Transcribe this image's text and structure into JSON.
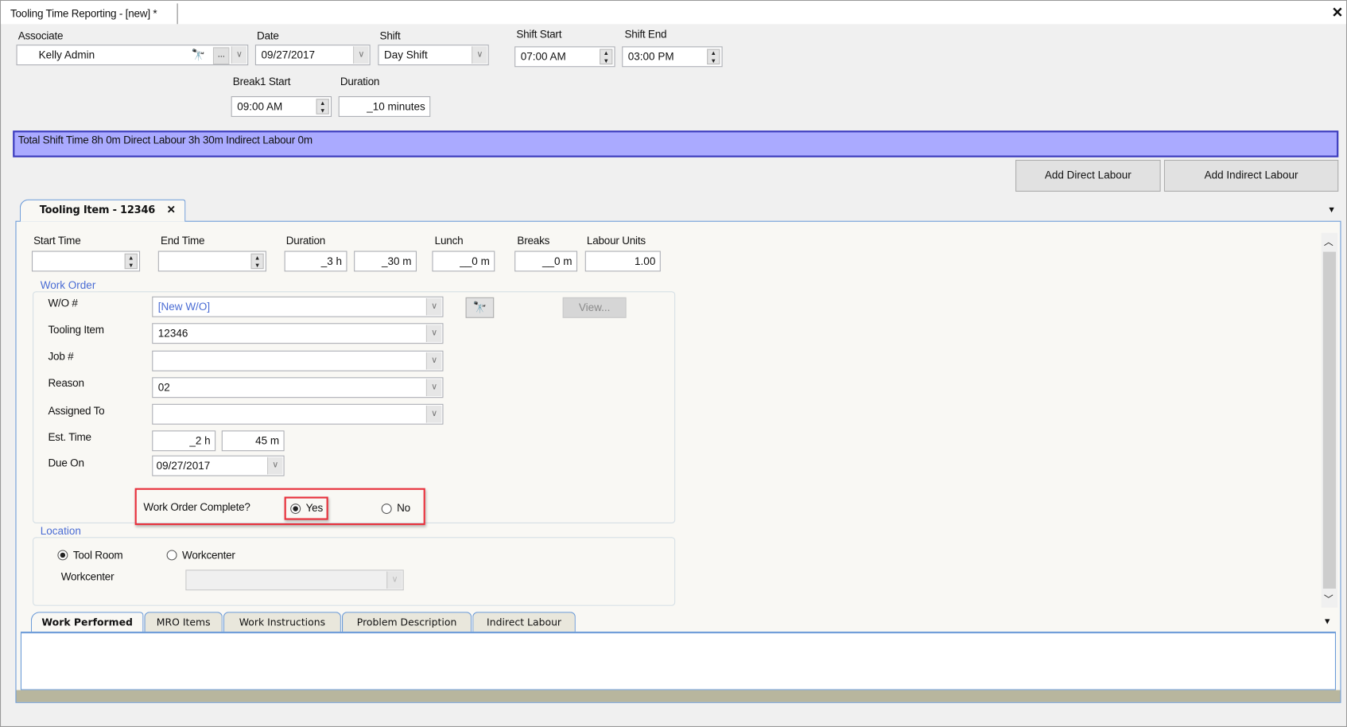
{
  "window": {
    "tab_title": "Tooling Time Reporting - [new] *",
    "close_icon": "close-icon"
  },
  "header": {
    "associate": {
      "label": "Associate",
      "value": "Kelly Admin",
      "ellipsis": "..."
    },
    "date": {
      "label": "Date",
      "value": "09/27/2017"
    },
    "shift": {
      "label": "Shift",
      "value": "Day Shift"
    },
    "shift_start": {
      "label": "Shift Start",
      "value": "07:00 AM"
    },
    "shift_end": {
      "label": "Shift End",
      "value": "03:00 PM"
    },
    "break1_start": {
      "label": "Break1 Start",
      "value": "09:00 AM"
    },
    "break_duration": {
      "label": "Duration",
      "value": "_10 minutes"
    }
  },
  "summary_bar": {
    "text": "Total Shift Time 8h 0m  Direct Labour 3h 30m  Indirect Labour 0m",
    "color": "#aaaaff"
  },
  "actions": {
    "add_direct": "Add Direct Labour",
    "add_indirect": "Add Indirect Labour"
  },
  "item_tab": {
    "label": "Tooling Item - 12346",
    "close": "✕"
  },
  "times": {
    "start_time": {
      "label": "Start Time",
      "value": ""
    },
    "end_time": {
      "label": "End Time",
      "value": ""
    },
    "duration": {
      "label": "Duration",
      "hours": "_3 h",
      "minutes": "_30 m"
    },
    "lunch": {
      "label": "Lunch",
      "value": "__0 m"
    },
    "breaks": {
      "label": "Breaks",
      "value": "__0 m"
    },
    "labour_units": {
      "label": "Labour Units",
      "value": "1.00"
    }
  },
  "work_order": {
    "legend": "Work Order",
    "wo": {
      "label": "W/O #",
      "value": "[New W/O]"
    },
    "view_button": "View...",
    "tooling_item": {
      "label": "Tooling Item",
      "value": "12346"
    },
    "job": {
      "label": "Job #",
      "value": ""
    },
    "reason": {
      "label": "Reason",
      "value": "02"
    },
    "assigned_to": {
      "label": "Assigned To",
      "value": ""
    },
    "est_time": {
      "label": "Est. Time",
      "hours": "_2 h",
      "minutes": "45 m"
    },
    "due_on": {
      "label": "Due On",
      "value": "09/27/2017"
    },
    "complete": {
      "label": "Work Order Complete?",
      "yes": "Yes",
      "no": "No",
      "selected": "Yes"
    }
  },
  "location": {
    "legend": "Location",
    "tool_room": "Tool Room",
    "workcenter_option": "Workcenter",
    "selected": "Tool Room",
    "workcenter_label": "Workcenter",
    "workcenter_value": ""
  },
  "bottom_tabs": [
    {
      "label": "Work Performed",
      "active": true
    },
    {
      "label": "MRO Items"
    },
    {
      "label": "Work Instructions"
    },
    {
      "label": "Problem Description"
    },
    {
      "label": "Indirect Labour"
    }
  ],
  "colors": {
    "highlight": "#e8313c",
    "accent": "#4a6cd4"
  }
}
